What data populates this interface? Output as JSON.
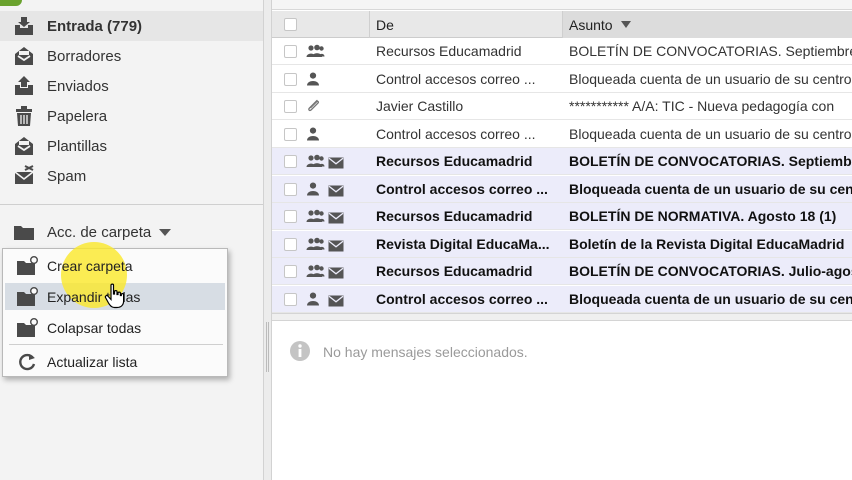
{
  "sidebar": {
    "folders": [
      {
        "label": "Entrada (779)",
        "icon": "inbox-icon",
        "selected": true
      },
      {
        "label": "Borradores",
        "icon": "drafts-icon",
        "selected": false
      },
      {
        "label": "Enviados",
        "icon": "sent-icon",
        "selected": false
      },
      {
        "label": "Papelera",
        "icon": "trash-icon",
        "selected": false
      },
      {
        "label": "Plantillas",
        "icon": "templates-icon",
        "selected": false
      },
      {
        "label": "Spam",
        "icon": "spam-icon",
        "selected": false
      }
    ],
    "folder_actions_label": "Acc. de carpeta"
  },
  "context_menu": {
    "items": [
      {
        "label": "Crear carpeta",
        "icon": "new-folder-icon"
      },
      {
        "label": "Expandir todas",
        "icon": "expand-folders-icon"
      },
      {
        "label": "Colapsar todas",
        "icon": "collapse-folders-icon"
      },
      {
        "label": "Actualizar lista",
        "icon": "refresh-icon"
      }
    ],
    "hovered_index": 1
  },
  "mail_list": {
    "columns": {
      "from": "De",
      "subject": "Asunto"
    },
    "sorted_column": "subject",
    "rows": [
      {
        "from": "Recursos Educamadrid",
        "subject": "BOLETÍN DE CONVOCATORIAS. Septiembre",
        "type": "group",
        "unread": false
      },
      {
        "from": "Control accesos correo ...",
        "subject": "Bloqueada cuenta de un usuario de su centro",
        "type": "person",
        "unread": false
      },
      {
        "from": "Javier Castillo",
        "subject": "*********** A/A: TIC - Nueva pedagogía con",
        "type": "attachment",
        "unread": false
      },
      {
        "from": "Control accesos correo ...",
        "subject": "Bloqueada cuenta de un usuario de su centro",
        "type": "person",
        "unread": false
      },
      {
        "from": "Recursos Educamadrid",
        "subject": "BOLETÍN DE CONVOCATORIAS. Septiembre",
        "type": "group",
        "unread": true
      },
      {
        "from": "Control accesos correo ...",
        "subject": "Bloqueada cuenta de un usuario de su centro",
        "type": "person",
        "unread": true
      },
      {
        "from": "Recursos Educamadrid",
        "subject": "BOLETÍN DE NORMATIVA. Agosto 18 (1)",
        "type": "group",
        "unread": true
      },
      {
        "from": "Revista Digital EducaMa...",
        "subject": "Boletín de la Revista Digital EducaMadrid",
        "type": "group",
        "unread": true
      },
      {
        "from": "Recursos Educamadrid",
        "subject": "BOLETÍN DE CONVOCATORIAS. Julio-agosto",
        "type": "group",
        "unread": true
      },
      {
        "from": "Control accesos correo ...",
        "subject": "Bloqueada cuenta de un usuario de su centro",
        "type": "person",
        "unread": true
      }
    ]
  },
  "preview": {
    "message": "No hay mensajes seleccionados."
  },
  "colors": {
    "accent_green": "#6aa22e",
    "unread_row": "#ececfa",
    "cursor_highlight": "#fae82d"
  }
}
